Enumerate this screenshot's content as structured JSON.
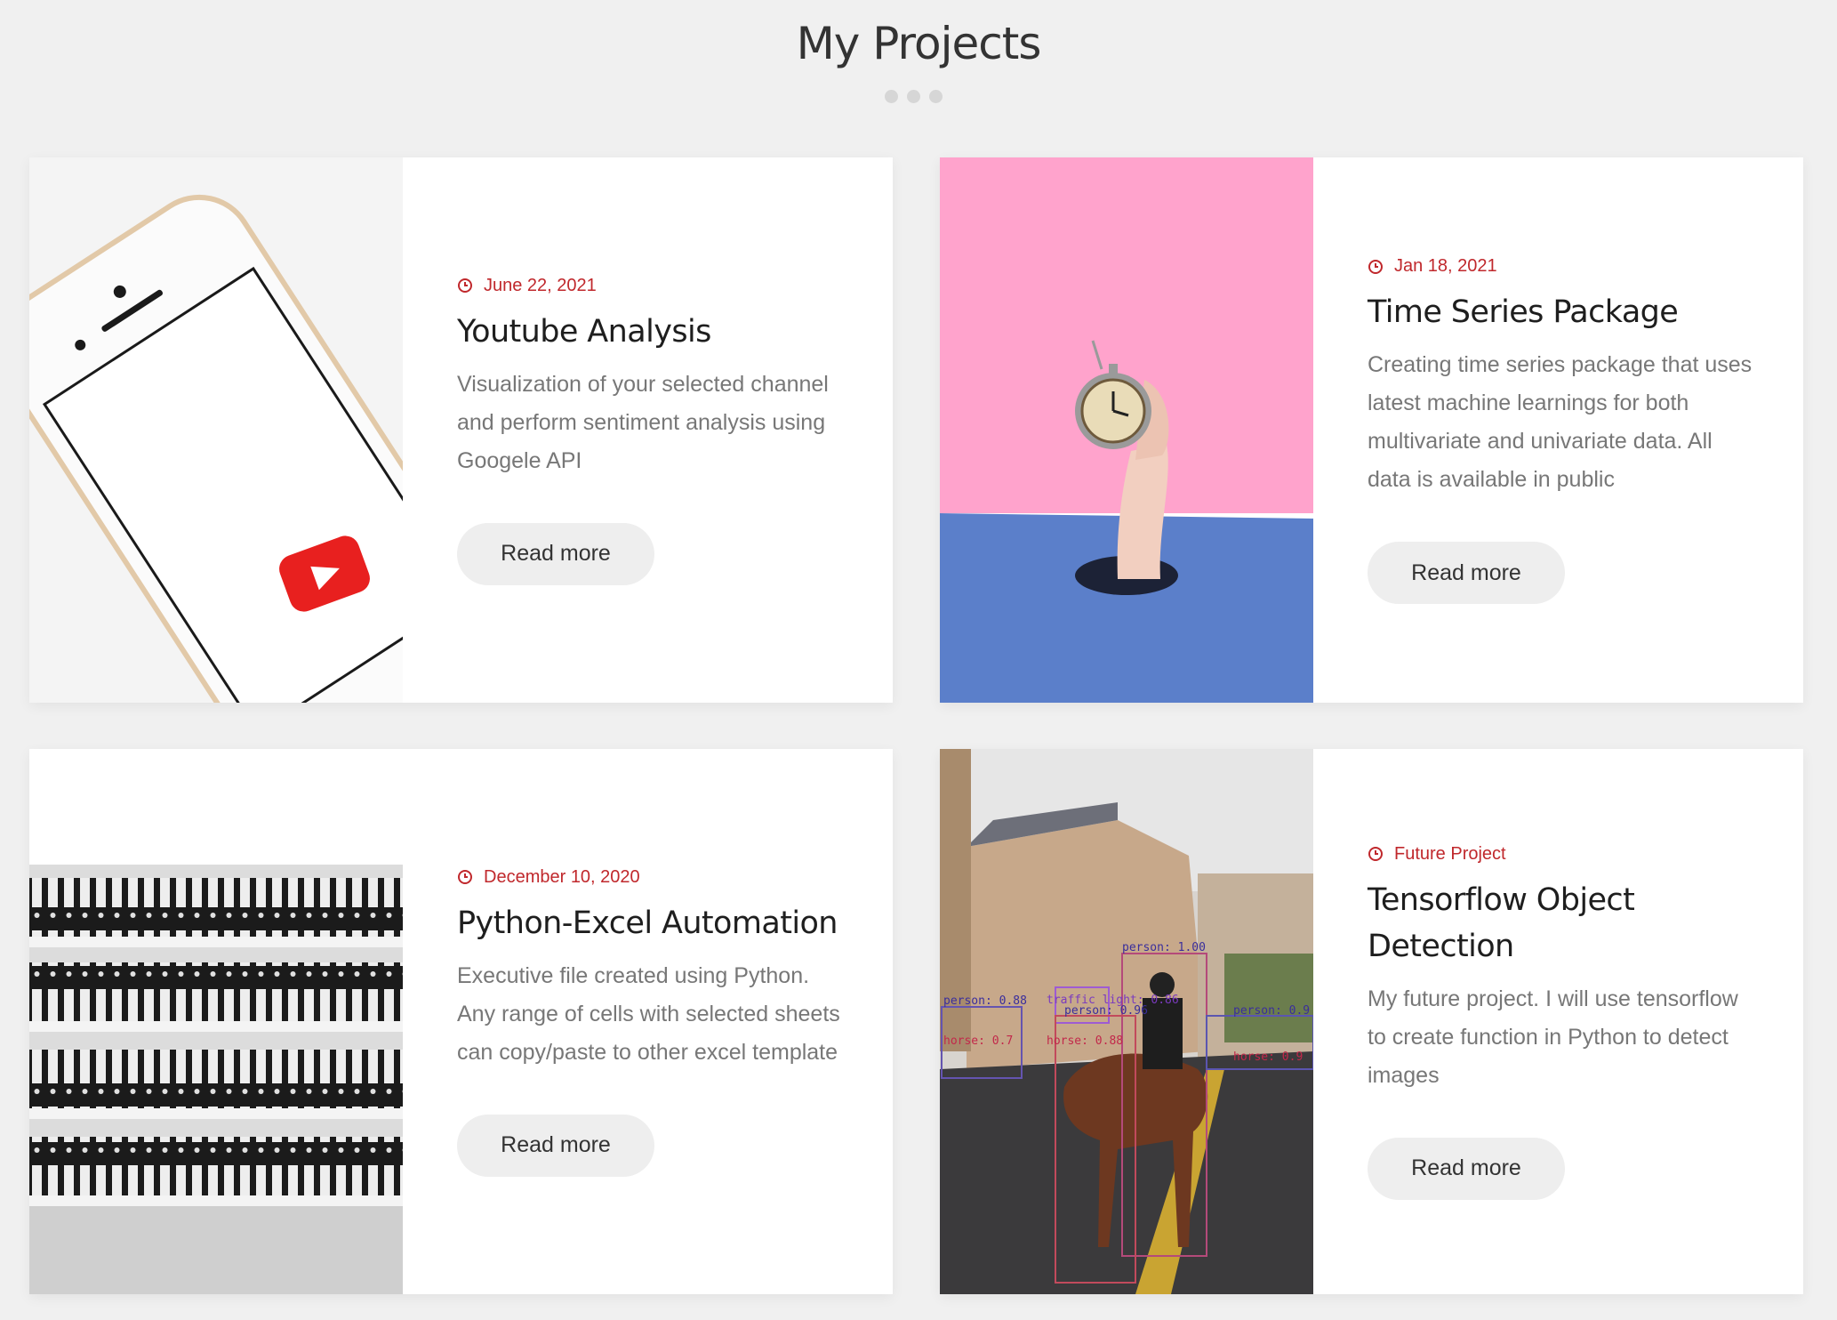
{
  "page": {
    "title": "My Projects"
  },
  "projects": [
    {
      "date": "June 22, 2021",
      "title": "Youtube Analysis",
      "description": "Visualization of your selected channel and perform sentiment analysis using Googele API",
      "button": "Read more",
      "image_icon": "phone-youtube-image"
    },
    {
      "date": "Jan 18, 2021",
      "title": "Time Series Package",
      "description": "Creating time series package that uses latest machine learnings for both multivariate and univariate data. All data is available in public",
      "button": "Read more",
      "image_icon": "alarm-clock-hand-image"
    },
    {
      "date": "December 10, 2020",
      "title": "Python-Excel Automation",
      "description": "Executive file created using Python. Any range of cells with selected sheets can copy/paste to other excel template",
      "button": "Read more",
      "image_icon": "binders-shelf-image"
    },
    {
      "date": "Future Project",
      "title": "Tensorflow Object Detection",
      "description": "My future project. I will use tensorflow to create function in Python to detect images",
      "button": "Read more",
      "image_icon": "object-detection-street-image"
    }
  ],
  "detection_labels": [
    "person: 1.00",
    "person: 0.88",
    "traffic light: 0.86",
    "person: 0.96",
    "person: 0.9",
    "horse: 0.7",
    "horse: 0.88",
    "horse: 0.9"
  ],
  "colors": {
    "accent": "#c0282c",
    "background": "#f0f0f0",
    "card": "#ffffff",
    "button": "#eeeeee"
  }
}
